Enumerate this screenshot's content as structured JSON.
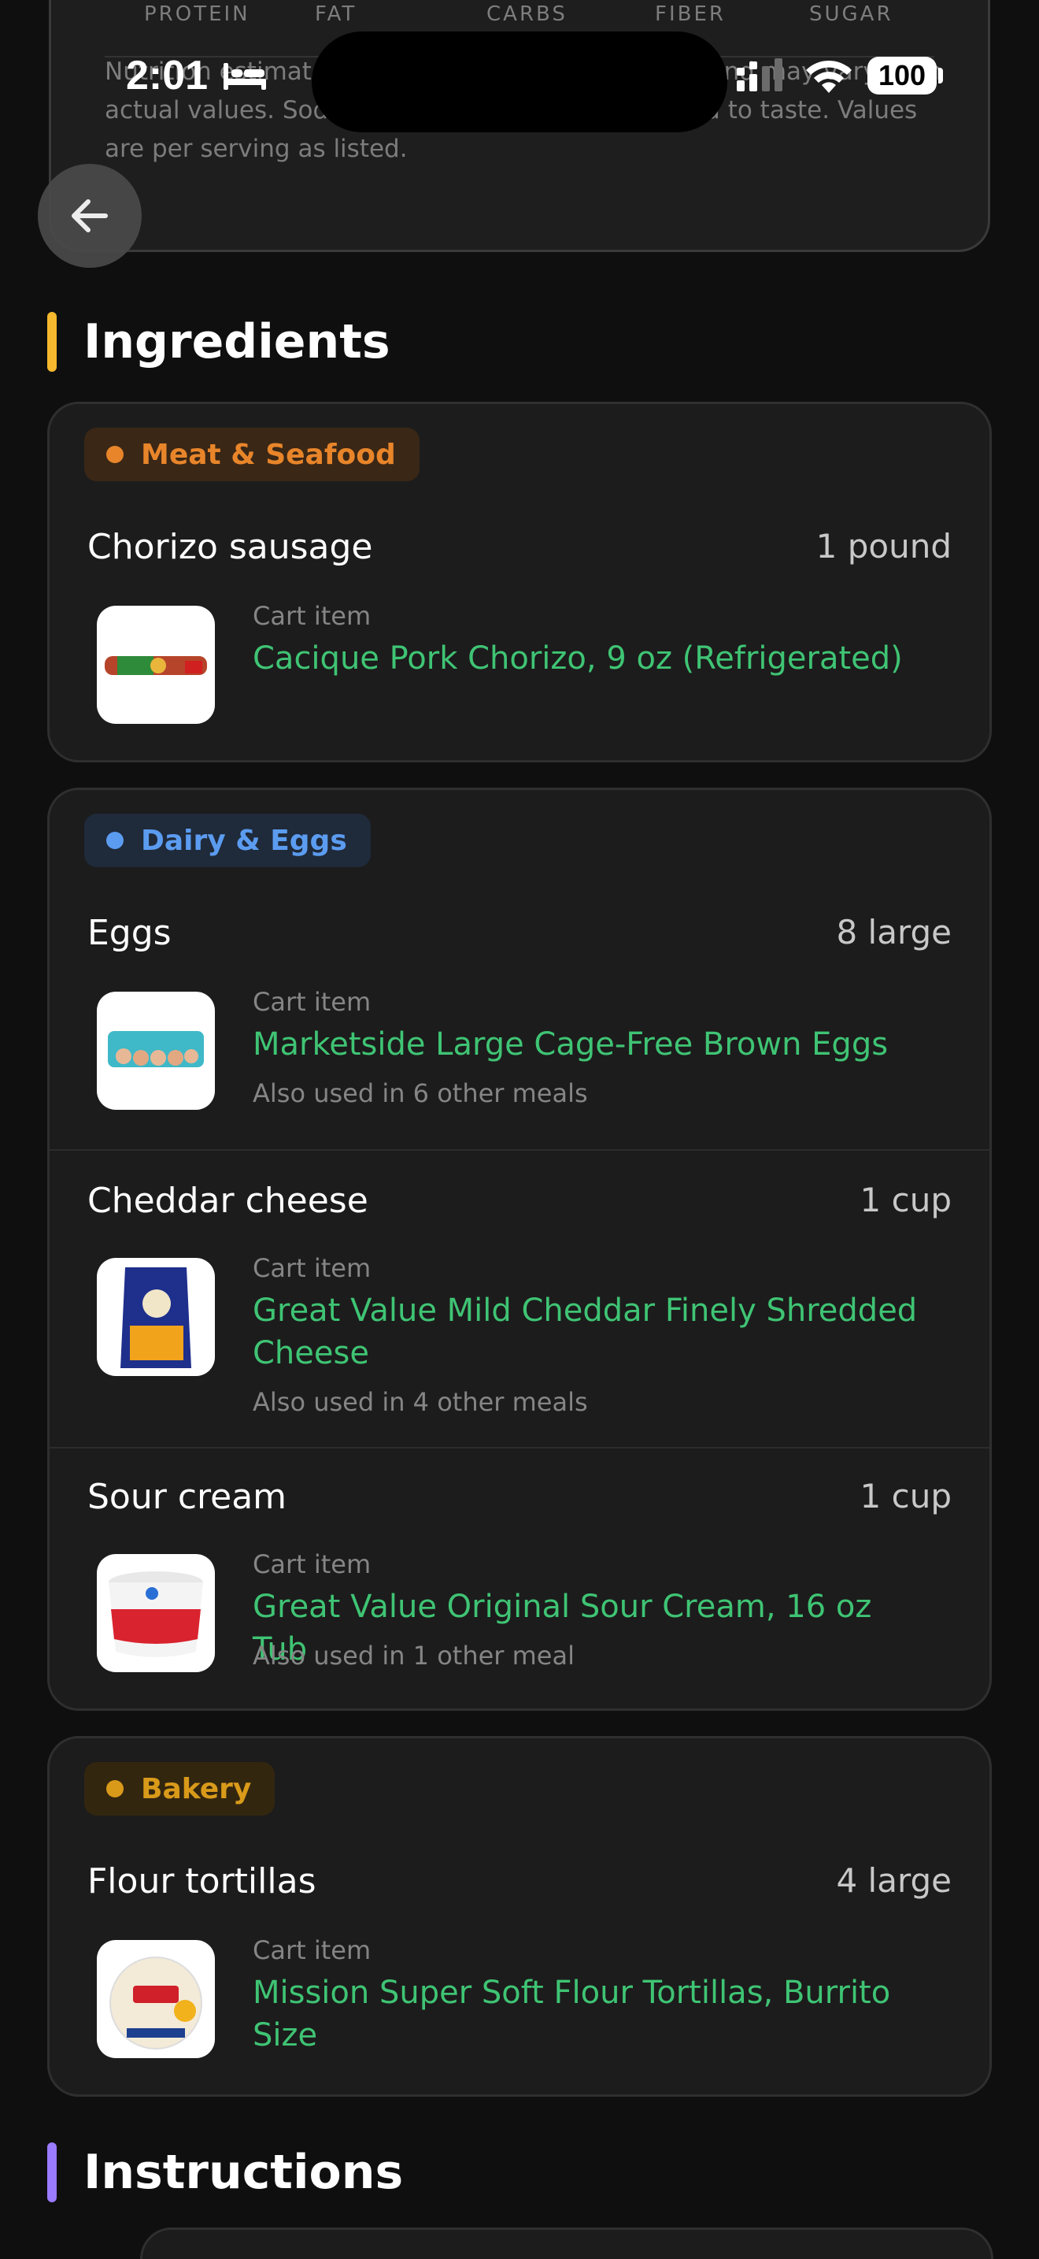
{
  "status_bar": {
    "time": "2:01",
    "battery": "100"
  },
  "nutrition": {
    "macro_labels": [
      "PROTEIN",
      "FAT",
      "CARBS",
      "FIBER",
      "SUGAR"
    ],
    "note": "Nutrition estimates are based on ingredient data and may vary from actual values. Sodium does not include salt added to taste. Values are per serving as listed."
  },
  "ingredients_title": "Ingredients",
  "instructions_title": "Instructions",
  "colors": {
    "accent_green": "#3fc474",
    "ingredients_bar": "#f5b82e",
    "instructions_bar": "#9b7bff",
    "meat_badge": "#e8852a",
    "dairy_badge": "#5b9cf0",
    "bakery_badge": "#d99a1a"
  },
  "categories": [
    {
      "name": "Meat & Seafood",
      "items": [
        {
          "name": "Chorizo sausage",
          "qty": "1 pound",
          "cart_label": "Cart item",
          "product": "Cacique Pork Chorizo, 9 oz (Refrigerated)",
          "also_used": ""
        }
      ]
    },
    {
      "name": "Dairy & Eggs",
      "items": [
        {
          "name": "Eggs",
          "qty": "8 large",
          "cart_label": "Cart item",
          "product": "Marketside Large Cage-Free Brown Eggs",
          "also_used": "Also used in 6 other meals"
        },
        {
          "name": "Cheddar cheese",
          "qty": "1 cup",
          "cart_label": "Cart item",
          "product": "Great Value Mild Cheddar Finely Shredded Cheese",
          "also_used": "Also used in 4 other meals"
        },
        {
          "name": "Sour cream",
          "qty": "1 cup",
          "cart_label": "Cart item",
          "product": "Great Value Original Sour Cream, 16 oz Tub",
          "also_used": "Also used in 1 other meal"
        }
      ]
    },
    {
      "name": "Bakery",
      "items": [
        {
          "name": "Flour tortillas",
          "qty": "4 large",
          "cart_label": "Cart item",
          "product": "Mission Super Soft Flour Tortillas, Burrito Size",
          "also_used": ""
        }
      ]
    }
  ]
}
